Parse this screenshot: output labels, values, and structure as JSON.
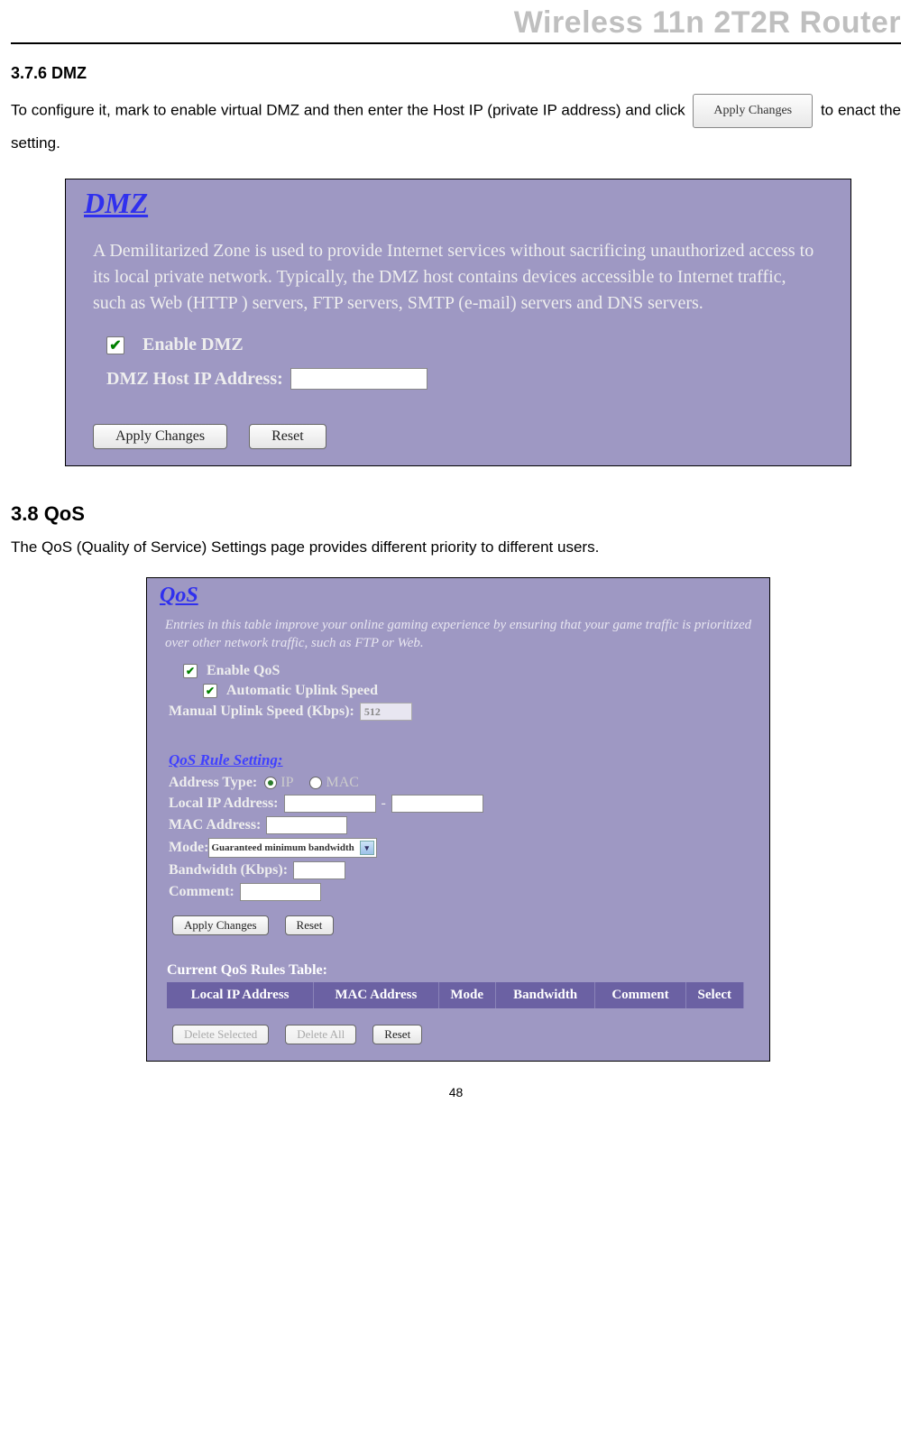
{
  "header": {
    "title": "Wireless 11n 2T2R Router"
  },
  "page_number": "48",
  "section_dmz": {
    "heading": "3.7.6   DMZ",
    "intro_pre": "To configure it, mark to enable virtual DMZ and then enter the Host IP (private IP address) and click ",
    "inline_button": "Apply Changes",
    "intro_post": " to enact the setting."
  },
  "shot_dmz": {
    "title": "DMZ",
    "desc": "A Demilitarized Zone is used to provide Internet services without sacrificing unauthorized access to its local private network. Typically, the DMZ host contains devices accessible to Internet traffic, such as Web (HTTP ) servers, FTP servers, SMTP (e-mail) servers and DNS servers.",
    "enable_label": "Enable DMZ",
    "host_label": "DMZ Host IP Address:",
    "btn_apply": "Apply Changes",
    "btn_reset": "Reset"
  },
  "section_qos": {
    "heading": "3.8    QoS",
    "intro": "The QoS (Quality of Service) Settings page provides different priority to different users."
  },
  "shot_qos": {
    "title": "QoS",
    "desc": "Entries in this table improve your online gaming experience by ensuring that your game traffic is prioritized over other network traffic, such as FTP or Web.",
    "enable_label": "Enable QoS",
    "auto_label": "Automatic Uplink Speed",
    "manual_label": "Manual Uplink Speed (Kbps):",
    "manual_value": "512",
    "rule_heading": "QoS Rule Setting:",
    "addr_type_label": "Address Type:",
    "addr_ip": "IP",
    "addr_mac": "MAC",
    "local_ip_label": "Local IP Address:",
    "dash": "-",
    "mac_label": "MAC Address:",
    "mode_label": "Mode:",
    "mode_value": "Guaranteed minimum bandwidth",
    "bandwidth_label": "Bandwidth (Kbps):",
    "comment_label": "Comment:",
    "btn_apply": "Apply Changes",
    "btn_reset": "Reset",
    "table_title": "Current QoS Rules Table:",
    "cols": [
      "Local IP Address",
      "MAC Address",
      "Mode",
      "Bandwidth",
      "Comment",
      "Select"
    ],
    "btn_del_sel": "Delete Selected",
    "btn_del_all": "Delete All",
    "btn_reset2": "Reset"
  }
}
